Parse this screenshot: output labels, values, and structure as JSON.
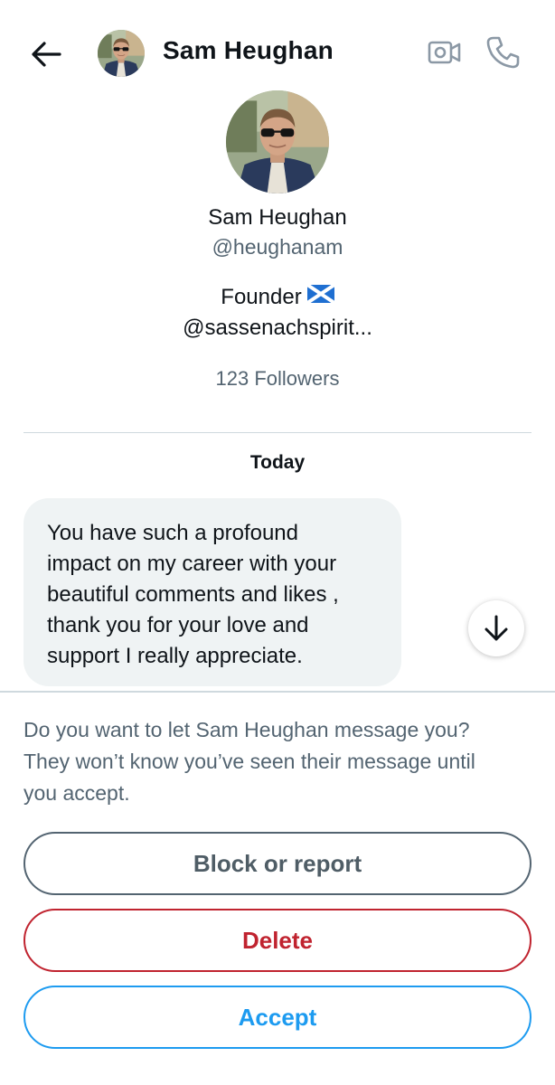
{
  "header": {
    "name": "Sam Heughan",
    "icons": [
      "back-arrow-icon",
      "video-call-icon",
      "phone-icon"
    ]
  },
  "profile": {
    "name": "Sam Heughan",
    "handle": "@heughanam",
    "bio_line1": "Founder",
    "bio_line2": "@sassenachspirit...",
    "flag_icon": "scotland-flag-icon",
    "followers": "123 Followers"
  },
  "conversation": {
    "date_label": "Today",
    "message_lines": [
      "You have such a profound",
      "impact on my career with your",
      "beautiful comments and likes ,",
      "thank you for your love and",
      "support I really appreciate."
    ]
  },
  "request": {
    "prompt_lines": [
      "Do you want to let Sam Heughan message you?",
      "They won’t know you’ve seen their message until",
      "you accept."
    ],
    "block_label": "Block or report",
    "delete_label": "Delete",
    "accept_label": "Accept"
  },
  "colors": {
    "text": "#0f1419",
    "secondary": "#536471",
    "danger": "#c0232f",
    "accent": "#1d9bf0",
    "bubble": "#eff3f4"
  }
}
